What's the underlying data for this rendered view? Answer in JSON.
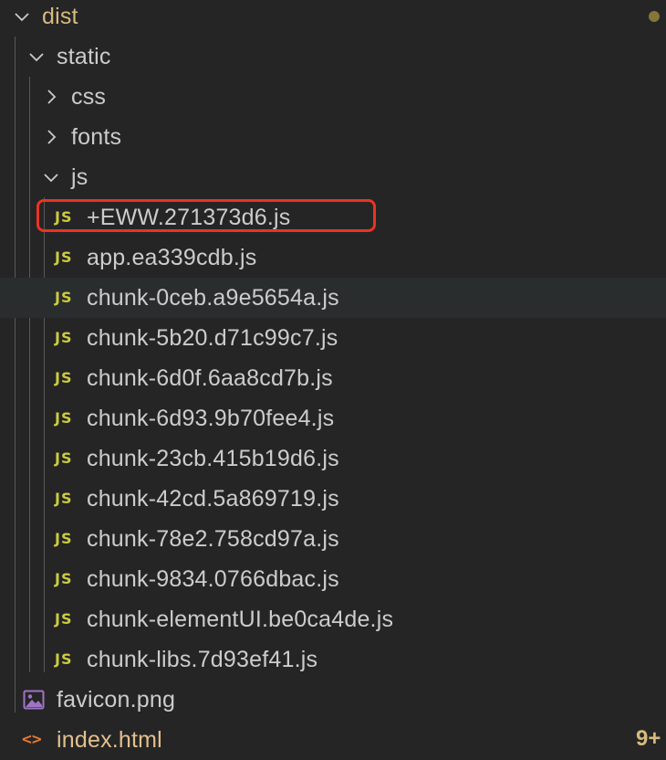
{
  "explorer": {
    "root": {
      "name": "dist",
      "expanded": true,
      "status_indicator": "modified-dot"
    },
    "static": {
      "name": "static",
      "expanded": true
    },
    "css": {
      "name": "css",
      "expanded": false
    },
    "fonts": {
      "name": "fonts",
      "expanded": false
    },
    "js": {
      "name": "js",
      "expanded": true
    },
    "js_icon_text": "JS",
    "js_files": [
      "+EWW.271373d6.js",
      "app.ea339cdb.js",
      "chunk-0ceb.a9e5654a.js",
      "chunk-5b20.d71c99c7.js",
      "chunk-6d0f.6aa8cd7b.js",
      "chunk-6d93.9b70fee4.js",
      "chunk-23cb.415b19d6.js",
      "chunk-42cd.5a869719.js",
      "chunk-78e2.758cd97a.js",
      "chunk-9834.0766dbac.js",
      "chunk-elementUI.be0ca4de.js",
      "chunk-libs.7d93ef41.js"
    ],
    "favicon": {
      "name": "favicon.png",
      "icon": "image-icon"
    },
    "index": {
      "name": "index.html",
      "icon": "html-icon",
      "icon_text": "<>",
      "badge": "9+"
    },
    "highlighted_file": "+EWW.271373d6.js",
    "hovered_file": "chunk-0ceb.a9e5654a.js"
  },
  "colors": {
    "background": "#252526",
    "text": "#cccccc",
    "modified": "#d7ba7d",
    "js_icon": "#cbcb41",
    "html_icon": "#e37933",
    "highlight_box": "#ea3323",
    "hover_row": "#2a2d2e"
  }
}
